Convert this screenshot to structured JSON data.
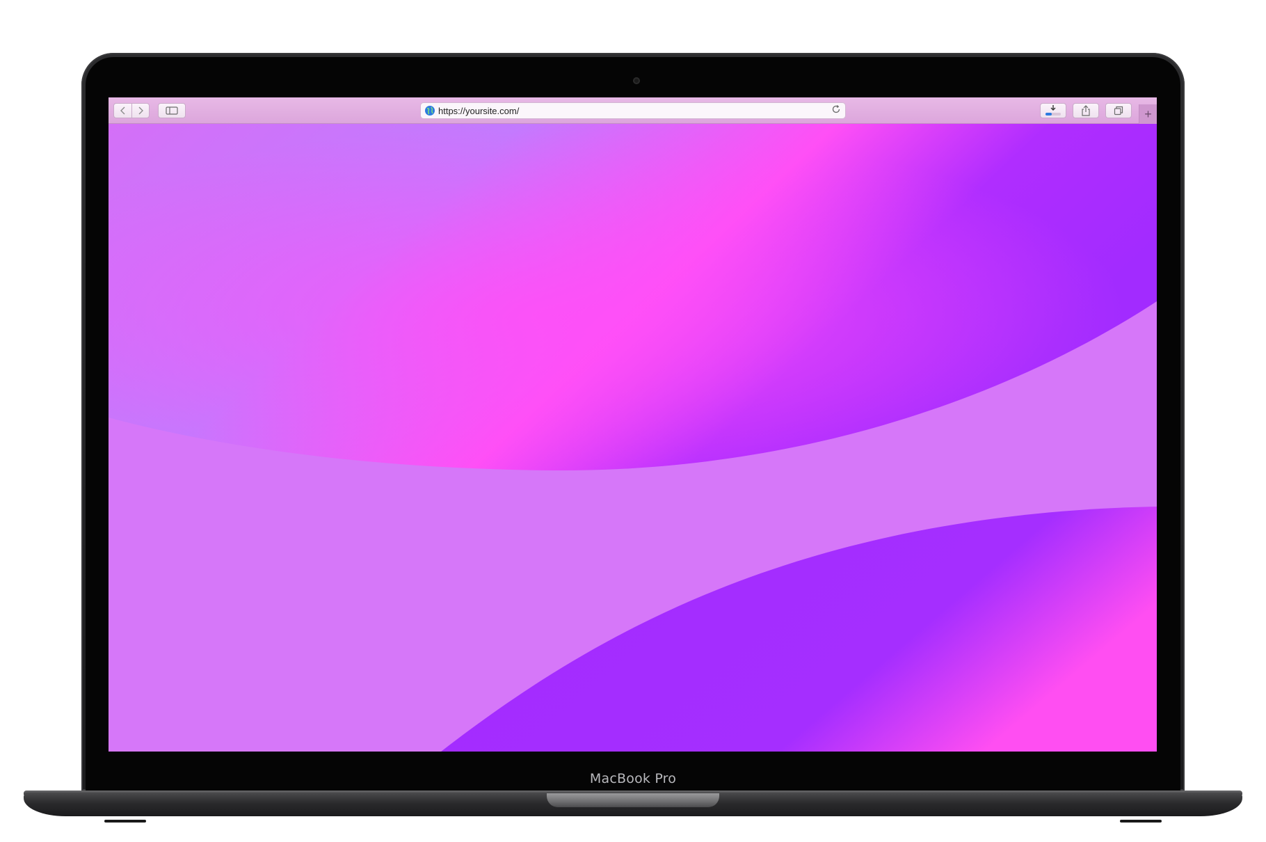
{
  "device": {
    "model_label": "MacBook Pro"
  },
  "browser": {
    "address_bar": {
      "url": "https://yoursite.com/"
    },
    "icons": {
      "back": "chevron-left-icon",
      "forward": "chevron-right-icon",
      "sidebar": "sidebar-icon",
      "site": "globe-icon",
      "reload": "reload-icon",
      "downloads": "download-icon",
      "share": "share-icon",
      "tabs": "tab-overview-icon",
      "new_tab": "plus-icon"
    }
  },
  "colors": {
    "toolbar": "#e2b0e0",
    "wallpaper_light": "#d677f9",
    "wallpaper_magenta": "#ff4ff6",
    "wallpaper_violet": "#a22bff",
    "wallpaper_lavender": "#c27bfe"
  }
}
